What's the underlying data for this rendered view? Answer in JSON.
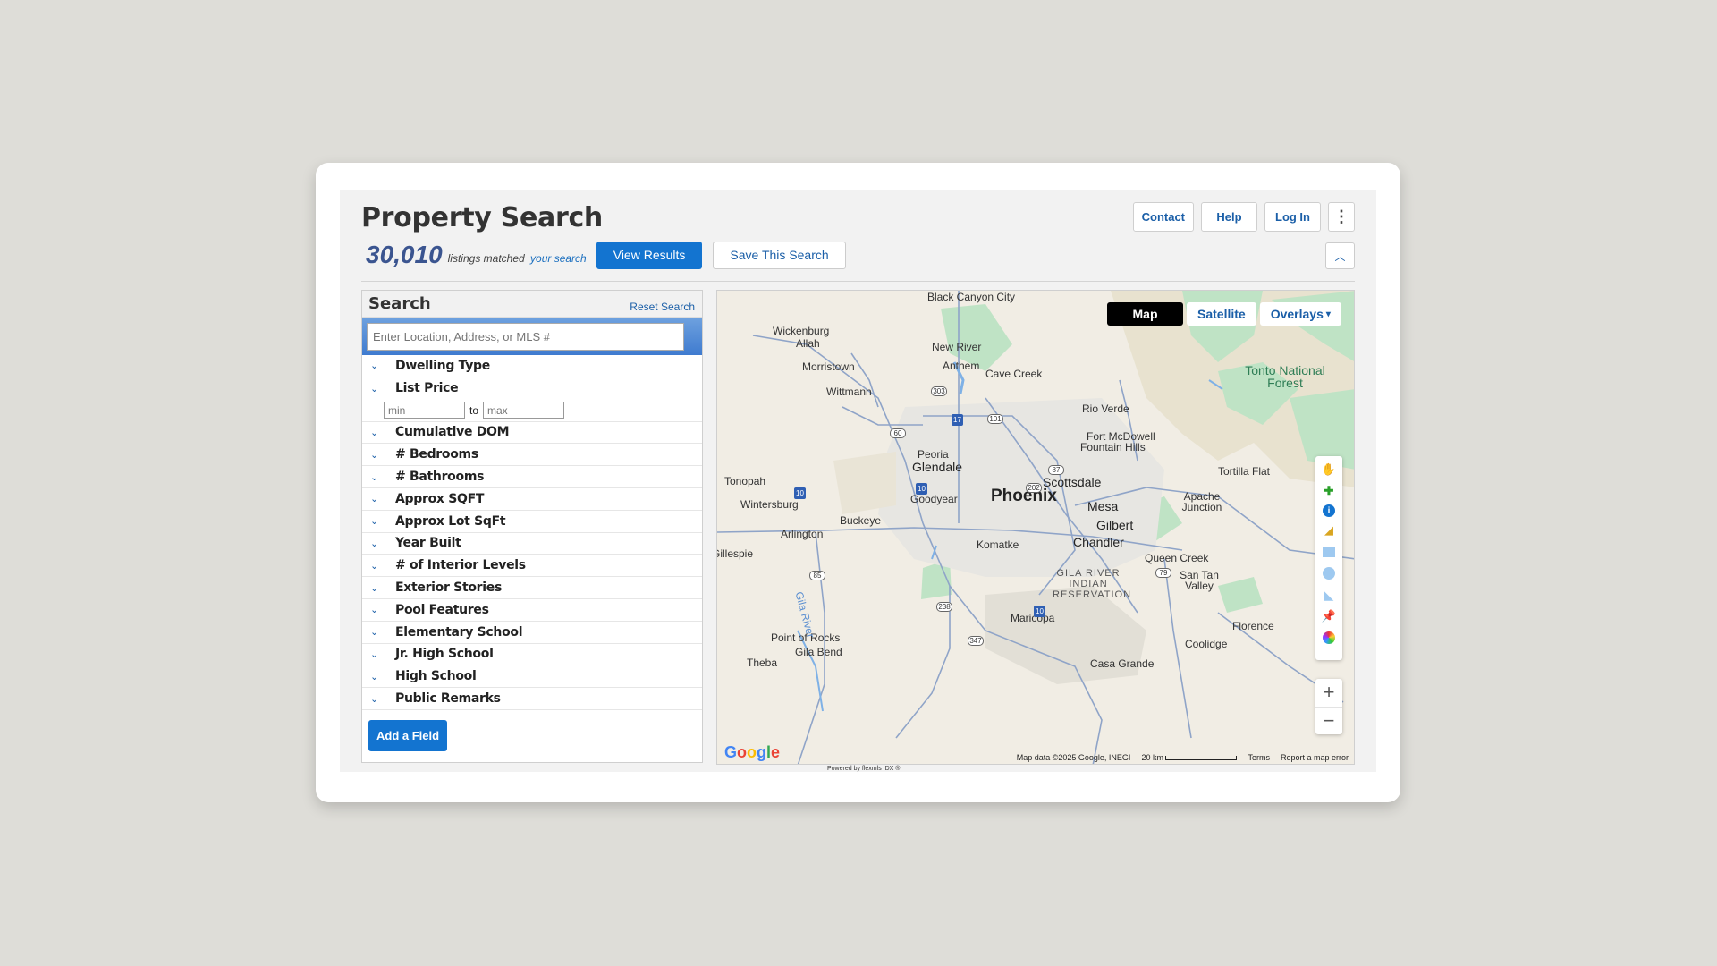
{
  "header": {
    "title": "Property Search",
    "contact_label": "Contact",
    "help_label": "Help",
    "login_label": "Log In",
    "count": "30,010",
    "matched_text": "listings matched",
    "your_search_text": "your search",
    "view_results_label": "View Results",
    "save_search_label": "Save This Search"
  },
  "search_panel": {
    "title": "Search",
    "reset_label": "Reset Search",
    "location_placeholder": "Enter Location, Address, or MLS #",
    "price_min_placeholder": "min",
    "price_max_placeholder": "max",
    "price_to": "to",
    "fields": [
      "Dwelling Type",
      "List Price",
      "Cumulative DOM",
      "# Bedrooms",
      "# Bathrooms",
      "Approx SQFT",
      "Approx Lot SqFt",
      "Year Built",
      "# of Interior Levels",
      "Exterior Stories",
      "Pool Features",
      "Elementary School",
      "Jr. High School",
      "High School",
      "Public Remarks"
    ],
    "add_field_label": "Add a Field"
  },
  "map": {
    "tabs": [
      "Map",
      "Satellite",
      "Overlays"
    ],
    "active_tab": "Map",
    "places": {
      "black_canyon_city": "Black Canyon City",
      "wickenburg": "Wickenburg",
      "allah": "Allah",
      "new_river": "New River",
      "anthem": "Anthem",
      "cave_creek": "Cave Creek",
      "morristown": "Morristown",
      "wittmann": "Wittmann",
      "rio_verde": "Rio Verde",
      "tonto": "Tonto National Forest",
      "fort_mcdowell": "Fort McDowell",
      "fountain_hills": "Fountain Hills",
      "peoria": "Peoria",
      "glendale": "Glendale",
      "scottsdale": "Scottsdale",
      "tortilla_flat": "Tortilla Flat",
      "tonopah": "Tonopah",
      "phoenix": "Phoenix",
      "wintersburg": "Wintersburg",
      "goodyear": "Goodyear",
      "mesa": "Mesa",
      "apache_junction": "Apache Junction",
      "buckeye": "Buckeye",
      "gilbert": "Gilbert",
      "arlington": "Arlington",
      "chandler": "Chandler",
      "komatke": "Komatke",
      "gillespie": "Gillespie",
      "queen_creek": "Queen Creek",
      "gila_river": "GILA RIVER INDIAN RESERVATION",
      "san_tan_valley": "San Tan Valley",
      "maricopa": "Maricopa",
      "florence": "Florence",
      "point_of_rocks": "Point of Rocks",
      "gila_bend": "Gila Bend",
      "coolidge": "Coolidge",
      "theba": "Theba",
      "casa_grande": "Casa Grande",
      "gila_river_label": "Gila River"
    },
    "attribution": {
      "map_data": "Map data ©2025 Google, INEGI",
      "scale": "20 km",
      "terms": "Terms",
      "report": "Report a map error",
      "google": "Google",
      "powered_by": "Powered by flexmls IDX ®"
    },
    "zoom_in": "+",
    "zoom_out": "−",
    "colors": {
      "accent": "#1374d0",
      "link": "#1b5fa8",
      "count": "#3b5590"
    }
  }
}
